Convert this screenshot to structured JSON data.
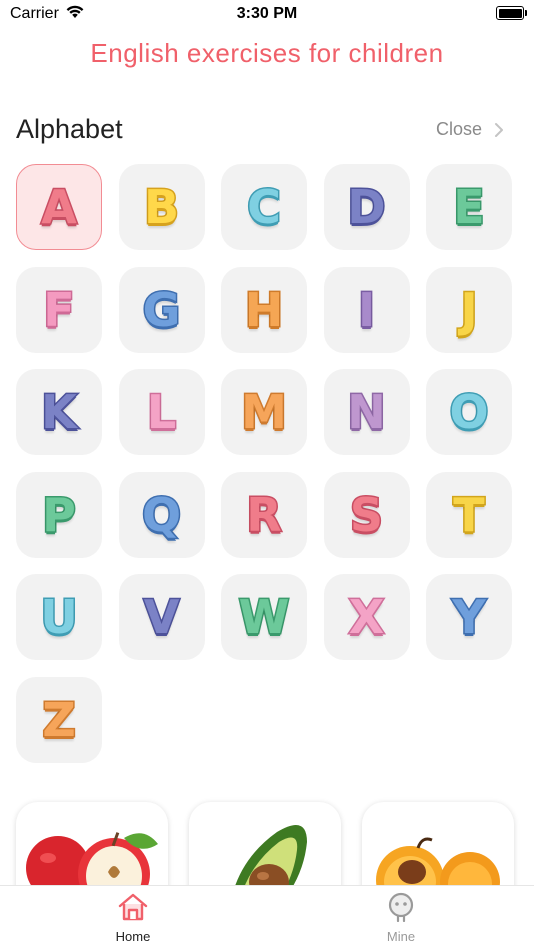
{
  "status_bar": {
    "carrier": "Carrier",
    "time": "3:30 PM"
  },
  "app_title": "English exercises for children",
  "alphabet_section": {
    "title": "Alphabet",
    "close_label": "Close"
  },
  "letters": [
    {
      "letter": "A",
      "color": "#f07c8a",
      "shade": "#c94e63",
      "selected": true
    },
    {
      "letter": "B",
      "color": "#ffd84a",
      "shade": "#d6a21e",
      "selected": false
    },
    {
      "letter": "C",
      "color": "#7fd0e2",
      "shade": "#3f9db4",
      "selected": false
    },
    {
      "letter": "D",
      "color": "#7b82c6",
      "shade": "#4d529a",
      "selected": false
    },
    {
      "letter": "E",
      "color": "#6cc99a",
      "shade": "#3a9a6c",
      "selected": false
    },
    {
      "letter": "F",
      "color": "#f49ac0",
      "shade": "#cf6a96",
      "selected": false
    },
    {
      "letter": "G",
      "color": "#6f9fdc",
      "shade": "#3f6fb0",
      "selected": false
    },
    {
      "letter": "H",
      "color": "#f5a654",
      "shade": "#cf7b2a",
      "selected": false
    },
    {
      "letter": "I",
      "color": "#a88acb",
      "shade": "#7a5da3",
      "selected": false
    },
    {
      "letter": "J",
      "color": "#f8d548",
      "shade": "#d2a51c",
      "selected": false
    },
    {
      "letter": "K",
      "color": "#7b82c6",
      "shade": "#4d529a",
      "selected": false
    },
    {
      "letter": "L",
      "color": "#f4a3c6",
      "shade": "#cf6f9a",
      "selected": false
    },
    {
      "letter": "M",
      "color": "#f6a55a",
      "shade": "#cf7b2f",
      "selected": false
    },
    {
      "letter": "N",
      "color": "#bf97cf",
      "shade": "#8f68a6",
      "selected": false
    },
    {
      "letter": "O",
      "color": "#7fd0e2",
      "shade": "#3f9db4",
      "selected": false
    },
    {
      "letter": "P",
      "color": "#6cc99a",
      "shade": "#3a9a6c",
      "selected": false
    },
    {
      "letter": "Q",
      "color": "#6f9fdc",
      "shade": "#3f6fb0",
      "selected": false
    },
    {
      "letter": "R",
      "color": "#f07c8a",
      "shade": "#c94e63",
      "selected": false
    },
    {
      "letter": "S",
      "color": "#f07c8a",
      "shade": "#c94e63",
      "selected": false
    },
    {
      "letter": "T",
      "color": "#f8d548",
      "shade": "#d2a51c",
      "selected": false
    },
    {
      "letter": "U",
      "color": "#7fd0e2",
      "shade": "#3f9db4",
      "selected": false
    },
    {
      "letter": "V",
      "color": "#7b82c6",
      "shade": "#4d529a",
      "selected": false
    },
    {
      "letter": "W",
      "color": "#6cc99a",
      "shade": "#3a9a6c",
      "selected": false
    },
    {
      "letter": "X",
      "color": "#f4a3c6",
      "shade": "#cf6f9a",
      "selected": false
    },
    {
      "letter": "Y",
      "color": "#6f9fdc",
      "shade": "#3f6fb0",
      "selected": false
    },
    {
      "letter": "Z",
      "color": "#f6a55a",
      "shade": "#cf7b2f",
      "selected": false
    }
  ],
  "cards": [
    {
      "name": "apple-card",
      "icon": "apple-icon"
    },
    {
      "name": "avocado-card",
      "icon": "avocado-icon"
    },
    {
      "name": "apricot-card",
      "icon": "apricot-icon"
    }
  ],
  "tab_bar": {
    "tabs": [
      {
        "label": "Home",
        "icon": "home-icon",
        "active": true
      },
      {
        "label": "Mine",
        "icon": "user-icon",
        "active": false
      }
    ]
  },
  "colors": {
    "accent": "#f0606a",
    "inactive": "#9a9a9a"
  }
}
